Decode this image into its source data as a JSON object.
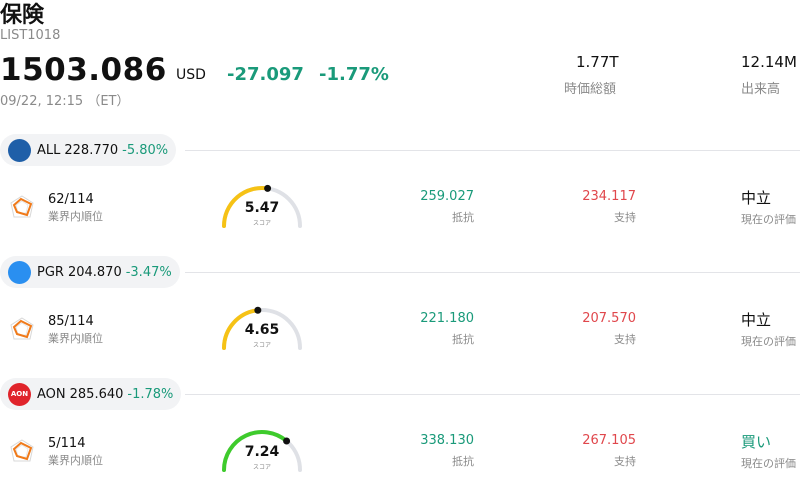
{
  "header": {
    "title": "保険",
    "code": "LIST1018",
    "price": "1503.086",
    "currency": "USD",
    "change": "-27.097",
    "change_pct": "-1.77%",
    "timestamp": "09/22, 12:15 （ET）",
    "market_cap_value": "1.77T",
    "market_cap_label": "時価総額",
    "volume_value": "12.14M",
    "volume_label": "出来高"
  },
  "labels": {
    "rank": "業界内順位",
    "score": "スコア",
    "resistance": "抵抗",
    "support": "支持",
    "evaluation": "現在の評価"
  },
  "stocks": [
    {
      "symbol": "ALL",
      "price": "228.770",
      "change_pct": "-5.80%",
      "logo_color": "#1f5fa8",
      "logo_text": "",
      "rank": "62/114",
      "score": "5.47",
      "score_value": 5.47,
      "gauge_color": "#f6c215",
      "resistance": "259.027",
      "support": "234.117",
      "evaluation": "中立"
    },
    {
      "symbol": "PGR",
      "price": "204.870",
      "change_pct": "-3.47%",
      "logo_color": "#2a8ff0",
      "logo_text": "",
      "rank": "85/114",
      "score": "4.65",
      "score_value": 4.65,
      "gauge_color": "#f6c215",
      "resistance": "221.180",
      "support": "207.570",
      "evaluation": "中立"
    },
    {
      "symbol": "AON",
      "price": "285.640",
      "change_pct": "-1.78%",
      "logo_color": "#e0242b",
      "logo_text": "AON",
      "rank": "5/114",
      "score": "7.24",
      "score_value": 7.24,
      "gauge_color": "#3ecb2c",
      "resistance": "338.130",
      "support": "267.105",
      "evaluation": "買い"
    }
  ]
}
